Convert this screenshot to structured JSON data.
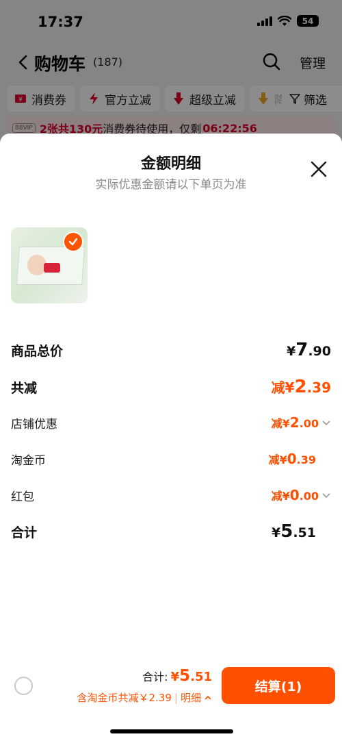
{
  "status": {
    "time": "17:37",
    "battery": "54"
  },
  "cart_header": {
    "title": "购物车",
    "count": "(187)",
    "manage": "管理"
  },
  "filters": [
    {
      "label": "消费券",
      "icon": "coupon-icon"
    },
    {
      "label": "官方立减",
      "icon": "lightning-icon"
    },
    {
      "label": "超级立减",
      "icon": "down-arrow-icon"
    },
    {
      "label": "降",
      "icon": "price-drop-icon"
    }
  ],
  "filter_button": "筛选",
  "vip_banner": {
    "tag": "88VIP",
    "red_text": "2张共130元",
    "text": "消费券待使用，仅剩",
    "countdown": "06:22:56"
  },
  "sheet": {
    "title": "金额明细",
    "subtitle": "实际优惠金额请以下单页为准"
  },
  "rows": {
    "total_price": {
      "label": "商品总价",
      "currency": "¥",
      "value": "7",
      "decimal": ".90"
    },
    "total_discount": {
      "label": "共减",
      "prefix": "减¥",
      "value": "2",
      "decimal": ".39"
    },
    "shop_discount": {
      "label": "店铺优惠",
      "prefix": "减¥",
      "value": "2",
      "decimal": ".00"
    },
    "taojinbi": {
      "label": "淘金币",
      "prefix": "减¥",
      "value": "0",
      "decimal": ".39"
    },
    "red_packet": {
      "label": "红包",
      "prefix": "减¥",
      "value": "0",
      "decimal": ".00"
    },
    "sum": {
      "label": "合计",
      "currency": "¥",
      "value": "5",
      "decimal": ".51"
    }
  },
  "bottom": {
    "total_label": "合计:",
    "currency": "¥",
    "total_value": "5",
    "total_decimal": ".51",
    "coin_text": "含淘金币共减￥2.39",
    "detail": "明细",
    "checkout": "结算(1)"
  },
  "colors": {
    "accent": "#ff5000",
    "vip_red": "#e0002a"
  }
}
